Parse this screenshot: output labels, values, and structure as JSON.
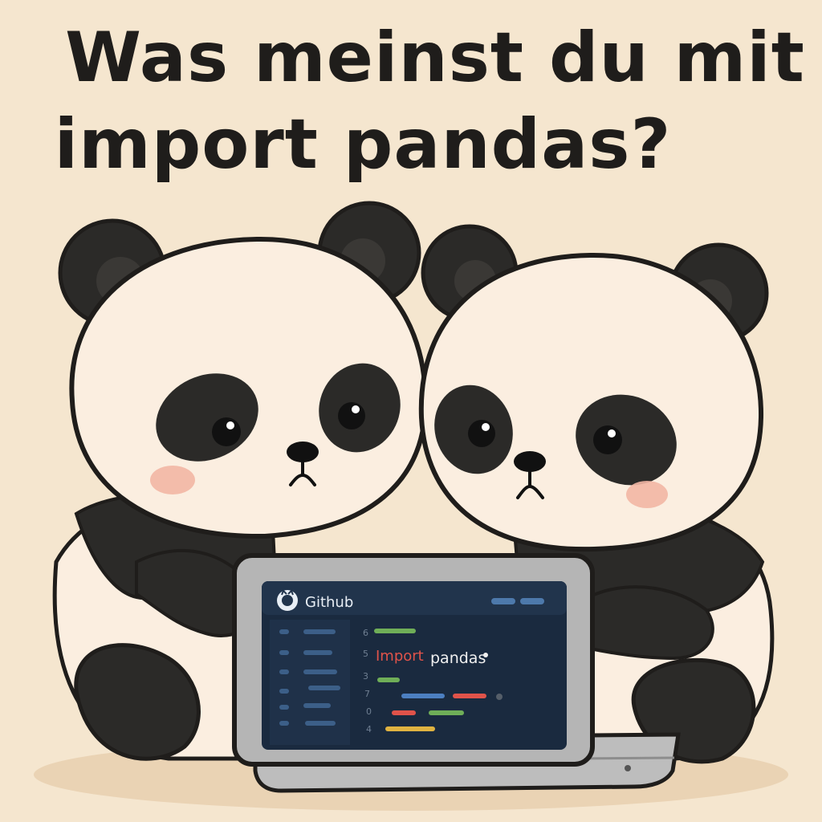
{
  "title": {
    "line1": "Was meinst du mit",
    "line2": "import pandas?"
  },
  "laptop": {
    "app_name": "Github",
    "app_icon": "github-octocat-icon",
    "code_keyword": "Import",
    "code_module": "pandas",
    "line_numbers": [
      "6",
      "5",
      "3",
      "7",
      "0",
      "4"
    ]
  },
  "colors": {
    "background": "#f5e6cf",
    "panda_fur_white": "#fbeee0",
    "panda_fur_black": "#2b2a28",
    "screen_bg": "#1a2a3f",
    "keyword_red": "#e0534a",
    "code_green": "#6fae58",
    "code_blue": "#4c7fc0",
    "code_yellow": "#e0b341"
  }
}
